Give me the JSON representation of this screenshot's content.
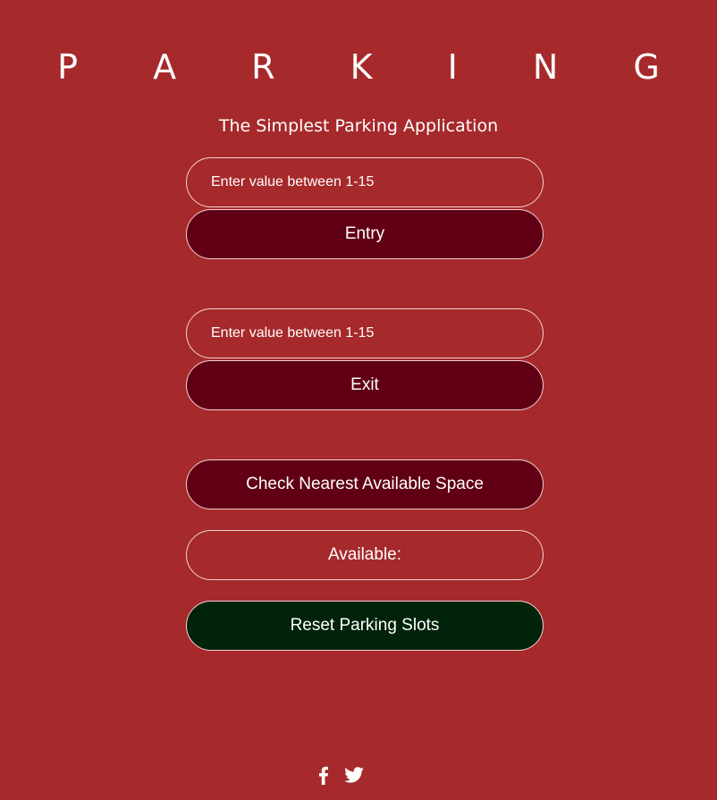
{
  "header": {
    "title": "P A R K I N G",
    "subtitle": "The Simplest Parking Application"
  },
  "entry": {
    "placeholder": "Enter value between 1-15",
    "button_label": "Entry"
  },
  "exit": {
    "placeholder": "Enter value between 1-15",
    "button_label": "Exit"
  },
  "check": {
    "button_label": "Check Nearest Available Space"
  },
  "available": {
    "label": "Available:"
  },
  "reset": {
    "button_label": "Reset Parking Slots"
  },
  "footer": {
    "icons": [
      "facebook-icon",
      "twitter-icon"
    ]
  },
  "colors": {
    "background": "#a6292b",
    "button": "#610014",
    "reset_button": "#00230a",
    "border": "#f1d2d3"
  }
}
